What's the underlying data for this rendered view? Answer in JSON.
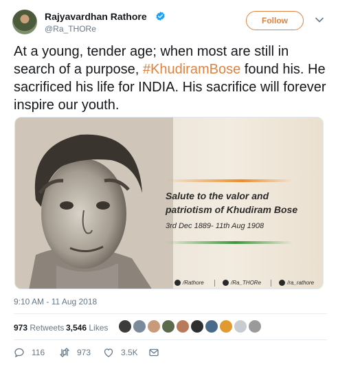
{
  "author": {
    "name": "Rajyavardhan Rathore",
    "handle": "@Ra_THORe",
    "verified": true
  },
  "follow_label": "Follow",
  "tweet": {
    "text_before": "At a young, tender age; when most are still in search of a purpose, ",
    "hashtag": "#KhudiramBose",
    "text_after": " found his. He sacrificed his life for INDIA. His sacrifice will forever inspire our youth."
  },
  "media": {
    "caption_title": "Salute to the valor and patriotism of Khudiram Bose",
    "caption_dates": "3rd Dec 1889- 11th Aug 1908",
    "socials": [
      {
        "icon": "facebook-icon",
        "label": "/Rathore"
      },
      {
        "icon": "twitter-icon",
        "label": "/Ra_THORe"
      },
      {
        "icon": "instagram-icon",
        "label": "/ra_rathore"
      }
    ]
  },
  "timestamp": "9:10 AM - 11 Aug 2018",
  "stats": {
    "retweets_count": "973",
    "retweets_label": "Retweets",
    "likes_count": "3,546",
    "likes_label": "Likes"
  },
  "likers_colors": [
    "#3b3b3b",
    "#7a8a9a",
    "#c79a7a",
    "#5a6a4a",
    "#b87a5a",
    "#2e2e2e",
    "#4a6a8a",
    "#e09a30",
    "#c8ccd0",
    "#9a9a9a"
  ],
  "actions": {
    "replies": "116",
    "retweets": "973",
    "likes": "3.5K"
  },
  "colors": {
    "accent": "#e0823d",
    "text": "#14171a",
    "muted": "#657786",
    "verified": "#1da1f2"
  }
}
